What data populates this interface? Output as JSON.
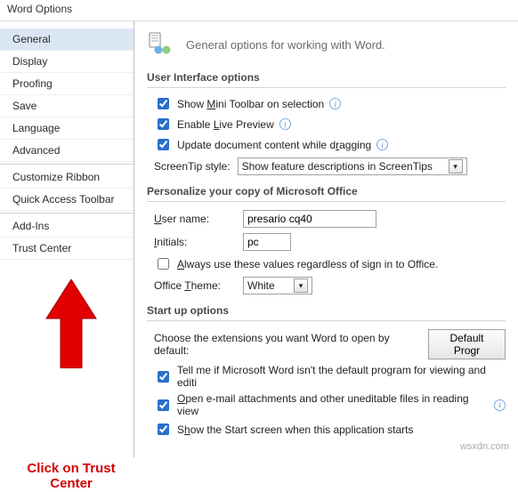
{
  "window": {
    "title": "Word Options"
  },
  "sidebar": {
    "items": [
      {
        "label": "General",
        "selected": true
      },
      {
        "label": "Display",
        "selected": false
      },
      {
        "label": "Proofing",
        "selected": false
      },
      {
        "label": "Save",
        "selected": false
      },
      {
        "label": "Language",
        "selected": false
      },
      {
        "label": "Advanced",
        "selected": false
      },
      {
        "label": "Customize Ribbon",
        "selected": false
      },
      {
        "label": "Quick Access Toolbar",
        "selected": false
      },
      {
        "label": "Add-Ins",
        "selected": false
      },
      {
        "label": "Trust Center",
        "selected": false
      }
    ]
  },
  "page": {
    "header": "General options for working with Word.",
    "icon": "settings-users-icon"
  },
  "ui_section": {
    "title": "User Interface options",
    "mini_toolbar": {
      "checked": true,
      "prefix": "Show ",
      "u": "M",
      "rest": "ini Toolbar on selection"
    },
    "live_preview": {
      "checked": true,
      "prefix": "Enable ",
      "u": "L",
      "rest": "ive Preview"
    },
    "drag_update": {
      "checked": true,
      "prefix": "Update document content while d",
      "u": "r",
      "rest": "agging"
    },
    "screentip_lbl": "ScreenTip style:",
    "screentip_val": "Show feature descriptions in ScreenTips"
  },
  "personalize": {
    "title": "Personalize your copy of Microsoft Office",
    "username_lbl": {
      "u": "U",
      "rest": "ser name:"
    },
    "username_val": "presario cq40",
    "initials_lbl": {
      "u": "I",
      "rest": "nitials:"
    },
    "initials_val": "pc",
    "always_use": {
      "checked": false,
      "u": "A",
      "rest": "lways use these values regardless of sign in to Office."
    },
    "theme_lbl": {
      "prefix": "Office ",
      "u": "T",
      "rest": "heme:"
    },
    "theme_val": "White"
  },
  "startup": {
    "title": "Start up options",
    "ext_text": "Choose the extensions you want Word to open by default:",
    "ext_btn": "Default Progr",
    "tellme": {
      "checked": true,
      "prefix": "Tell me if Microsoft Word isn't the default program for viewing and editi",
      "u": "",
      "rest": ""
    },
    "open_view": {
      "checked": true,
      "u": "O",
      "rest": "pen e-mail attachments and other uneditable files in reading view"
    },
    "startscr": {
      "checked": true,
      "prefix": "S",
      "u": "h",
      "rest": "ow the Start screen when this application starts"
    }
  },
  "annotation": {
    "text": "Click on Trust Center"
  },
  "watermark": "wsxdn.com"
}
